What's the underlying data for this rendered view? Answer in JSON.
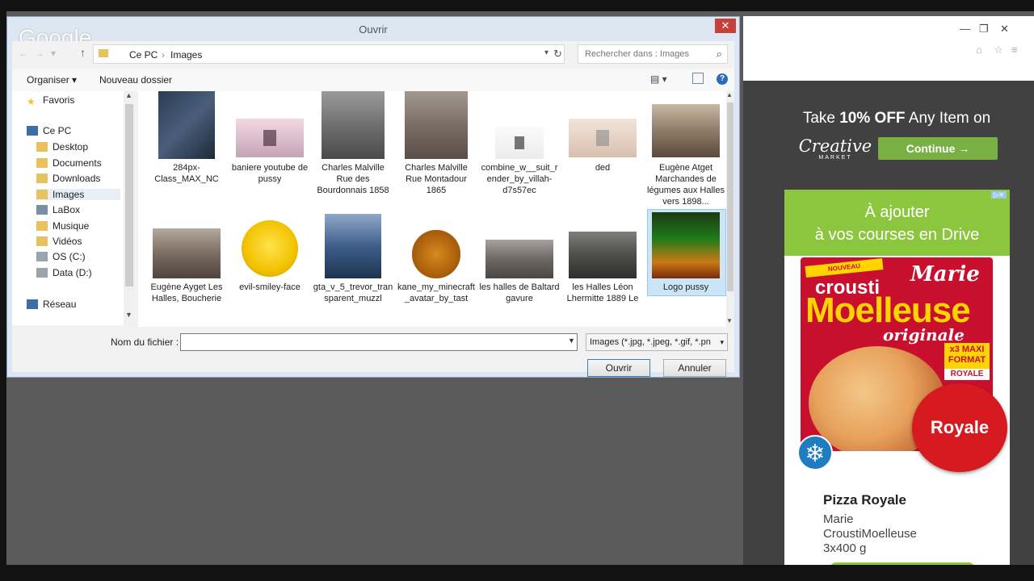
{
  "dialog": {
    "title": "Ouvrir",
    "close_label": "✕",
    "background_overlay_text": "Google",
    "address": {
      "crumb1": "Ce PC",
      "sep": "›",
      "crumb2": "Images"
    },
    "search_placeholder": "Rechercher dans : Images",
    "toolbar": {
      "organiser": "Organiser ▾",
      "nouveau_dossier": "Nouveau dossier"
    },
    "nav": [
      {
        "label": "Favoris",
        "icon": "star-icon"
      },
      {
        "label": "Ce PC",
        "icon": "computer-icon"
      },
      {
        "label": "Desktop",
        "icon": "folder-icon"
      },
      {
        "label": "Documents",
        "icon": "folder-icon"
      },
      {
        "label": "Downloads",
        "icon": "folder-icon"
      },
      {
        "label": "Images",
        "icon": "folder-icon"
      },
      {
        "label": "LaBox",
        "icon": "network-folder-icon"
      },
      {
        "label": "Musique",
        "icon": "folder-icon"
      },
      {
        "label": "Vidéos",
        "icon": "folder-icon"
      },
      {
        "label": "OS (C:)",
        "icon": "drive-icon"
      },
      {
        "label": "Data (D:)",
        "icon": "drive-icon"
      },
      {
        "label": "Réseau",
        "icon": "network-icon"
      }
    ],
    "files_row1": [
      "284px-Class_MAX_NC",
      "baniere youtube de pussy",
      "Charles Malville Rue des Bourdonnais 1858",
      "Charles Malville Rue Montadour 1865",
      "combine_w__suit_render_by_villah-d7s57ec",
      "ded",
      "Eugène Atget Marchandes de légumes aux Halles vers 1898..."
    ],
    "files_row2": [
      "Eugène Ayget Les Halles, Boucherie",
      "evil-smiley-face",
      "gta_v_5_trevor_transparent_muzzl",
      "kane_my_minecraft_avatar_by_tast",
      "les halles de Baltard gavure",
      "les Halles Léon Lhermitte 1889 Le",
      "Logo pussy"
    ],
    "filename_label": "Nom du fichier :",
    "filename_value": "",
    "filter_value": "Images (*.jpg, *.jpeg, *.gif, *.pn",
    "open_button": "Ouvrir",
    "cancel_button": "Annuler"
  },
  "ads": {
    "creative": {
      "prefix": "Take ",
      "bold": "10% OFF",
      "suffix": " Any Item on",
      "logo": "Creative",
      "logo_sub": "MARKET",
      "button": "Continue →"
    },
    "marie": {
      "headline_line1": "À ajouter",
      "headline_line2": "à vos courses en Drive",
      "badge": "NOUVEAU",
      "brand": "Marie",
      "crousti": "crousti",
      "moelleuse": "Moelleuse",
      "originale": "originale",
      "format": "x3 MAXI FORMAT",
      "royale_tag": "ROYALE",
      "royale": "Royale",
      "product_title": "Pizza Royale",
      "desc1": "Marie",
      "desc2": "CroustiMoelleuse",
      "desc3": "3x400 g"
    }
  },
  "colors": {
    "accent_green": "#8cc63f",
    "close_red": "#c7403a",
    "royale_red": "#d71920"
  }
}
